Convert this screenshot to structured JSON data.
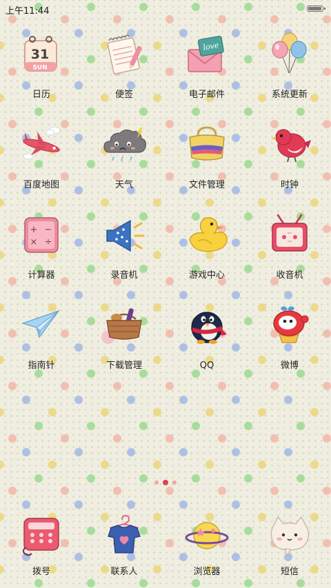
{
  "status_bar": {
    "time": "上午11:44",
    "battery_level": 0.95
  },
  "apps": [
    {
      "label": "日历",
      "icon": "calendar-icon",
      "day": "31",
      "weekday": "SUN"
    },
    {
      "label": "便签",
      "icon": "notepad-icon"
    },
    {
      "label": "电子邮件",
      "icon": "envelope-icon",
      "sticker": "love"
    },
    {
      "label": "系统更新",
      "icon": "balloons-icon"
    },
    {
      "label": "百度地图",
      "icon": "airplane-icon"
    },
    {
      "label": "天气",
      "icon": "rain-cloud-icon"
    },
    {
      "label": "文件管理",
      "icon": "bag-icon"
    },
    {
      "label": "时钟",
      "icon": "bird-icon"
    },
    {
      "label": "计算器",
      "icon": "calculator-icon"
    },
    {
      "label": "录音机",
      "icon": "megaphone-icon"
    },
    {
      "label": "游戏中心",
      "icon": "duck-icon"
    },
    {
      "label": "收音机",
      "icon": "tv-radio-icon"
    },
    {
      "label": "指南针",
      "icon": "paper-plane-icon"
    },
    {
      "label": "下载管理",
      "icon": "basket-icon"
    },
    {
      "label": "QQ",
      "icon": "penguin-icon"
    },
    {
      "label": "微博",
      "icon": "weibo-mascot-icon"
    }
  ],
  "pager": {
    "count": 3,
    "active": 1
  },
  "dock": [
    {
      "label": "拨号",
      "icon": "telephone-icon"
    },
    {
      "label": "联系人",
      "icon": "shirt-hanger-icon"
    },
    {
      "label": "浏览器",
      "icon": "planet-icon"
    },
    {
      "label": "短信",
      "icon": "cat-bubble-icon"
    }
  ]
}
